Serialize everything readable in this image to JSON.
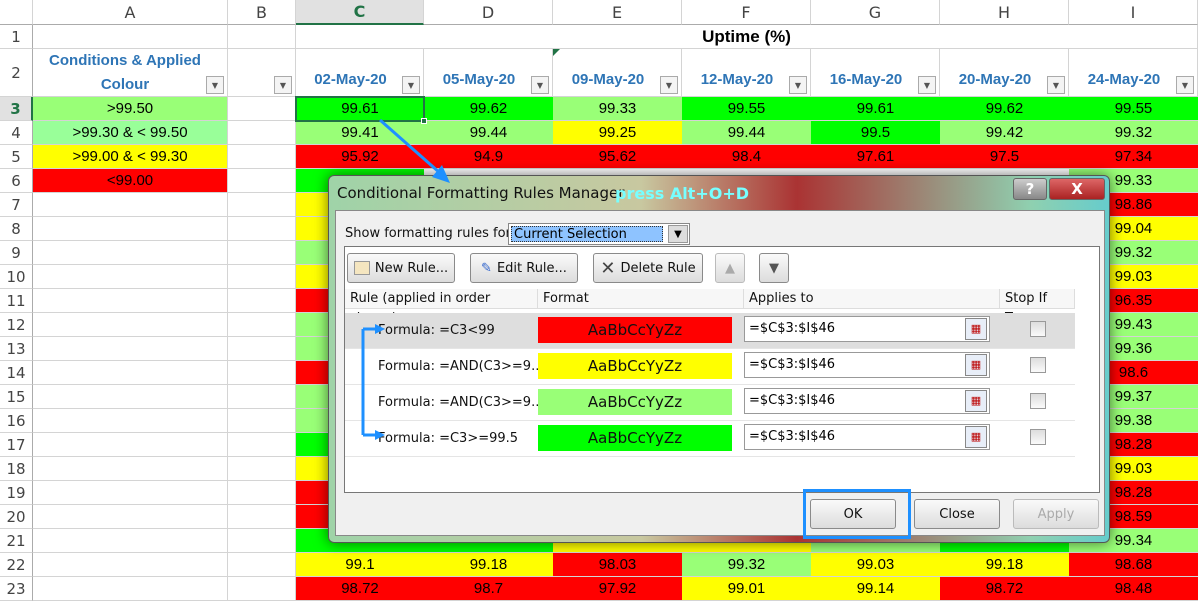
{
  "colors": {
    "G": "#00ff00",
    "L": "#99ff77",
    "Y": "#ffff00",
    "R": "#ff0000",
    "accent": "#2e75b6",
    "highlight": "#1e90ff"
  },
  "sheet": {
    "columns": [
      "A",
      "B",
      "C",
      "D",
      "E",
      "F",
      "G",
      "H",
      "I"
    ],
    "selected_column": "C",
    "selected_row": 3,
    "title": "Uptime (%)",
    "legend_header": "Conditions & Applied Colour",
    "legend": [
      {
        "label": ">99.50",
        "color": "L"
      },
      {
        "label": ">99.30 & < 99.50",
        "color": "L2"
      },
      {
        "label": ">99.00 & < 99.30",
        "color": "Y"
      },
      {
        "label": "<99.00",
        "color": "R"
      }
    ],
    "dates": [
      "02-May-20",
      "05-May-20",
      "09-May-20",
      "12-May-20",
      "16-May-20",
      "20-May-20",
      "24-May-20"
    ],
    "rows": [
      {
        "n": 3,
        "cells": [
          [
            "99.61",
            "G"
          ],
          [
            "99.62",
            "G"
          ],
          [
            "99.33",
            "L"
          ],
          [
            "99.55",
            "G"
          ],
          [
            "99.61",
            "G"
          ],
          [
            "99.62",
            "G"
          ],
          [
            "99.55",
            "G"
          ]
        ]
      },
      {
        "n": 4,
        "cells": [
          [
            "99.41",
            "L"
          ],
          [
            "99.44",
            "L"
          ],
          [
            "99.25",
            "Y"
          ],
          [
            "99.44",
            "L"
          ],
          [
            "99.5",
            "G"
          ],
          [
            "99.42",
            "L"
          ],
          [
            "99.32",
            "L"
          ]
        ]
      },
      {
        "n": 5,
        "cells": [
          [
            "95.92",
            "R"
          ],
          [
            "94.9",
            "R"
          ],
          [
            "95.62",
            "R"
          ],
          [
            "98.4",
            "R"
          ],
          [
            "97.61",
            "R"
          ],
          [
            "97.5",
            "R"
          ],
          [
            "97.34",
            "R"
          ]
        ]
      },
      {
        "n": 6,
        "cells": [
          [
            null,
            "G"
          ],
          [
            null,
            null
          ],
          [
            null,
            null
          ],
          [
            null,
            null
          ],
          [
            null,
            null
          ],
          [
            null,
            null
          ],
          [
            "99.33",
            "L"
          ]
        ]
      },
      {
        "n": 7,
        "cells": [
          [
            null,
            "Y"
          ],
          [
            null,
            null
          ],
          [
            null,
            null
          ],
          [
            null,
            null
          ],
          [
            null,
            null
          ],
          [
            null,
            null
          ],
          [
            "98.86",
            "R"
          ]
        ]
      },
      {
        "n": 8,
        "cells": [
          [
            null,
            "Y"
          ],
          [
            null,
            null
          ],
          [
            null,
            null
          ],
          [
            null,
            null
          ],
          [
            null,
            null
          ],
          [
            null,
            null
          ],
          [
            "99.04",
            "Y"
          ]
        ]
      },
      {
        "n": 9,
        "cells": [
          [
            null,
            "L"
          ],
          [
            null,
            null
          ],
          [
            null,
            null
          ],
          [
            null,
            null
          ],
          [
            null,
            null
          ],
          [
            null,
            null
          ],
          [
            "99.32",
            "L"
          ]
        ]
      },
      {
        "n": 10,
        "cells": [
          [
            null,
            "Y"
          ],
          [
            null,
            null
          ],
          [
            null,
            null
          ],
          [
            null,
            null
          ],
          [
            null,
            null
          ],
          [
            null,
            null
          ],
          [
            "99.03",
            "Y"
          ]
        ]
      },
      {
        "n": 11,
        "cells": [
          [
            null,
            "R"
          ],
          [
            null,
            null
          ],
          [
            null,
            null
          ],
          [
            null,
            null
          ],
          [
            null,
            null
          ],
          [
            null,
            null
          ],
          [
            "96.35",
            "R"
          ]
        ]
      },
      {
        "n": 12,
        "cells": [
          [
            null,
            "L"
          ],
          [
            null,
            null
          ],
          [
            null,
            null
          ],
          [
            null,
            null
          ],
          [
            null,
            null
          ],
          [
            null,
            null
          ],
          [
            "99.43",
            "L"
          ]
        ]
      },
      {
        "n": 13,
        "cells": [
          [
            null,
            "L"
          ],
          [
            null,
            null
          ],
          [
            null,
            null
          ],
          [
            null,
            null
          ],
          [
            null,
            null
          ],
          [
            null,
            null
          ],
          [
            "99.36",
            "L"
          ]
        ]
      },
      {
        "n": 14,
        "cells": [
          [
            null,
            "R"
          ],
          [
            null,
            null
          ],
          [
            null,
            null
          ],
          [
            null,
            null
          ],
          [
            null,
            null
          ],
          [
            null,
            null
          ],
          [
            "98.6",
            "R"
          ]
        ]
      },
      {
        "n": 15,
        "cells": [
          [
            null,
            "L"
          ],
          [
            null,
            null
          ],
          [
            null,
            null
          ],
          [
            null,
            null
          ],
          [
            null,
            null
          ],
          [
            null,
            null
          ],
          [
            "99.37",
            "L"
          ]
        ]
      },
      {
        "n": 16,
        "cells": [
          [
            null,
            "L"
          ],
          [
            null,
            null
          ],
          [
            null,
            null
          ],
          [
            null,
            null
          ],
          [
            null,
            null
          ],
          [
            null,
            null
          ],
          [
            "99.38",
            "L"
          ]
        ]
      },
      {
        "n": 17,
        "cells": [
          [
            null,
            "G"
          ],
          [
            null,
            null
          ],
          [
            null,
            null
          ],
          [
            null,
            null
          ],
          [
            null,
            null
          ],
          [
            null,
            null
          ],
          [
            "98.28",
            "R"
          ]
        ]
      },
      {
        "n": 18,
        "cells": [
          [
            null,
            "Y"
          ],
          [
            null,
            null
          ],
          [
            null,
            null
          ],
          [
            null,
            null
          ],
          [
            null,
            null
          ],
          [
            null,
            null
          ],
          [
            "99.03",
            "Y"
          ]
        ]
      },
      {
        "n": 19,
        "cells": [
          [
            null,
            "R"
          ],
          [
            null,
            null
          ],
          [
            null,
            null
          ],
          [
            null,
            null
          ],
          [
            null,
            null
          ],
          [
            null,
            null
          ],
          [
            "98.28",
            "R"
          ]
        ]
      },
      {
        "n": 20,
        "cells": [
          [
            null,
            "R"
          ],
          [
            null,
            null
          ],
          [
            null,
            null
          ],
          [
            null,
            null
          ],
          [
            null,
            null
          ],
          [
            null,
            null
          ],
          [
            "98.59",
            "R"
          ]
        ]
      },
      {
        "n": 21,
        "cells": [
          [
            null,
            "G"
          ],
          [
            null,
            "G"
          ],
          [
            null,
            "Y"
          ],
          [
            null,
            "Y"
          ],
          [
            null,
            "L"
          ],
          [
            null,
            "G"
          ],
          [
            "99.34",
            "L"
          ]
        ]
      },
      {
        "n": 22,
        "cells": [
          [
            "99.1",
            "Y"
          ],
          [
            "99.18",
            "Y"
          ],
          [
            "98.03",
            "R"
          ],
          [
            "99.32",
            "L"
          ],
          [
            "99.03",
            "Y"
          ],
          [
            "99.18",
            "Y"
          ],
          [
            "98.68",
            "R"
          ]
        ]
      },
      {
        "n": 23,
        "cells": [
          [
            "98.72",
            "R"
          ],
          [
            "98.7",
            "R"
          ],
          [
            "97.92",
            "R"
          ],
          [
            "99.01",
            "Y"
          ],
          [
            "99.14",
            "Y"
          ],
          [
            "98.72",
            "R"
          ],
          [
            "98.48",
            "R"
          ]
        ]
      }
    ]
  },
  "dialog": {
    "title": "Conditional Formatting Rules Manager",
    "annotation": "press Alt+O+D",
    "help": "?",
    "close": "X",
    "show_label": "Show formatting rules for:",
    "show_value": "Current Selection",
    "new_rule": "New Rule...",
    "edit_rule": "Edit Rule...",
    "delete_rule": "Delete Rule",
    "col_rule": "Rule (applied in order shown)",
    "col_format": "Format",
    "col_applies": "Applies to",
    "col_stop": "Stop If True",
    "preview_text": "AaBbCcYyZz",
    "rules": [
      {
        "formula": "Formula: =C3<99",
        "color": "R",
        "applies": "=$C$3:$I$46",
        "stop": false
      },
      {
        "formula": "Formula: =AND(C3>=9...",
        "color": "Y",
        "applies": "=$C$3:$I$46",
        "stop": false
      },
      {
        "formula": "Formula: =AND(C3>=9...",
        "color": "L",
        "applies": "=$C$3:$I$46",
        "stop": false
      },
      {
        "formula": "Formula: =C3>=99.5",
        "color": "G",
        "applies": "=$C$3:$I$46",
        "stop": false
      }
    ],
    "ok": "OK",
    "close_btn": "Close",
    "apply": "Apply"
  }
}
